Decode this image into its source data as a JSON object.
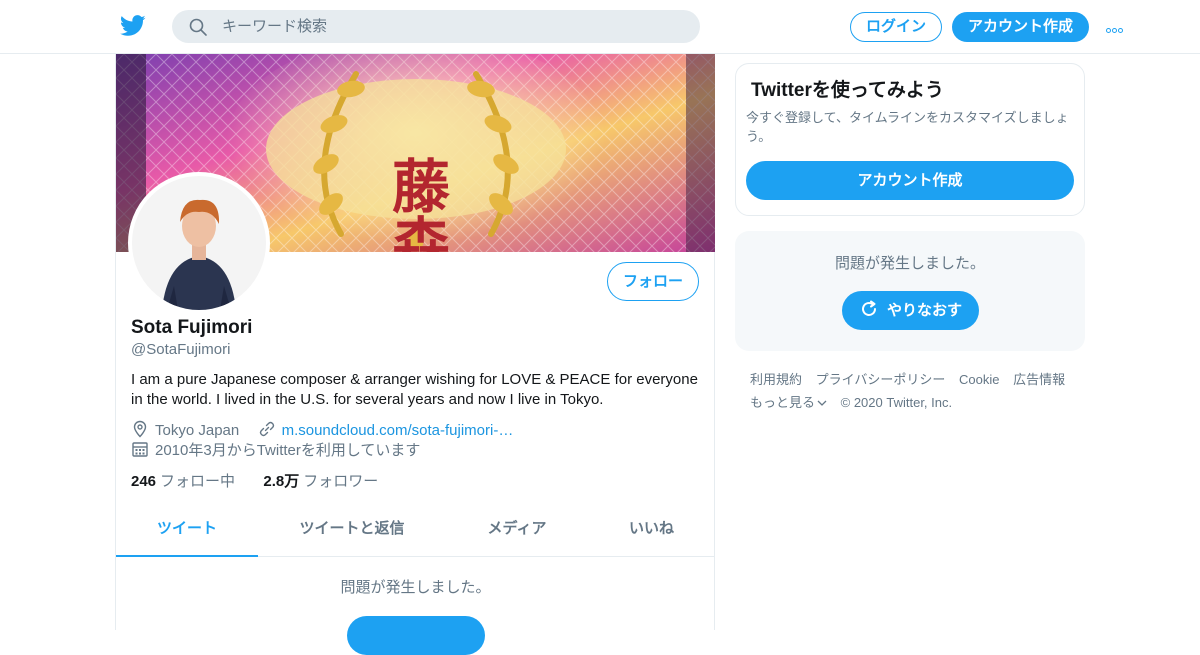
{
  "header": {
    "search_placeholder": "キーワード検索",
    "login_label": "ログイン",
    "signup_label": "アカウント作成"
  },
  "profile": {
    "name": "Sota Fujimori",
    "handle": "@SotaFujimori",
    "follow_label": "フォロー",
    "bio": "I am a pure Japanese composer & arranger wishing for LOVE & PEACE for everyone in the world. I lived in the U.S. for several years and now I live in Tokyo.",
    "location": "Tokyo Japan",
    "url": "m.soundcloud.com/sota-fujimori-…",
    "joined": "2010年3月からTwitterを利用しています",
    "following_count": "246",
    "following_label": "フォロー中",
    "followers_count": "2.8万",
    "followers_label": "フォロワー",
    "banner_text": "藤森"
  },
  "tabs": [
    {
      "label": "ツイート",
      "active": true
    },
    {
      "label": "ツイートと返信",
      "active": false
    },
    {
      "label": "メディア",
      "active": false
    },
    {
      "label": "いいね",
      "active": false
    }
  ],
  "main": {
    "error_text": "問題が発生しました。"
  },
  "sidebar": {
    "card_title": "Twitterを使ってみよう",
    "card_desc": "今すぐ登録して、タイムラインをカスタマイズしましょう。",
    "card_signup_label": "アカウント作成",
    "error_text": "問題が発生しました。",
    "retry_label": "やりなおす"
  },
  "footer": {
    "links": [
      "利用規約",
      "プライバシーポリシー",
      "Cookie",
      "広告情報",
      "もっと見る"
    ],
    "copyright": "© 2020 Twitter, Inc."
  },
  "colors": {
    "accent": "#1da1f2",
    "muted": "#657786",
    "text": "#14171a",
    "border": "#e6ecf0"
  }
}
